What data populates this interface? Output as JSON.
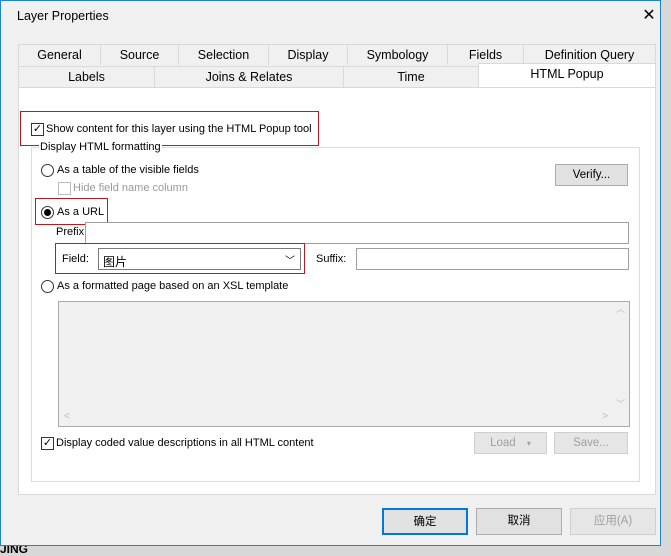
{
  "window": {
    "title": "Layer Properties"
  },
  "tabs_row1": [
    "General",
    "Source",
    "Selection",
    "Display",
    "Symbology",
    "Fields",
    "Definition Query"
  ],
  "tabs_row2": [
    "Labels",
    "Joins & Relates",
    "Time",
    "HTML Popup"
  ],
  "active_tab": "HTML Popup",
  "popup": {
    "show_content_label": "Show content for this layer using the HTML Popup tool",
    "show_content_checked": true,
    "group_label": "Display HTML formatting",
    "option_table": "As a table of the visible fields",
    "hide_field_name": "Hide field name column",
    "verify": "Verify...",
    "option_url": "As a URL",
    "prefix_label": "Prefix:",
    "prefix_value": "",
    "field_label": "Field:",
    "field_value": "图片",
    "suffix_label": "Suffix:",
    "suffix_value": "",
    "option_xsl": "As a formatted page based on an XSL template",
    "coded_values_label": "Display coded value descriptions in all HTML content",
    "coded_values_checked": true,
    "load": "Load",
    "save": "Save..."
  },
  "footer": {
    "ok": "确定",
    "cancel": "取消",
    "apply": "应用(A)"
  },
  "background_text": "JING",
  "colors": {
    "highlight": "#c4161c",
    "accent": "#1883d7"
  }
}
